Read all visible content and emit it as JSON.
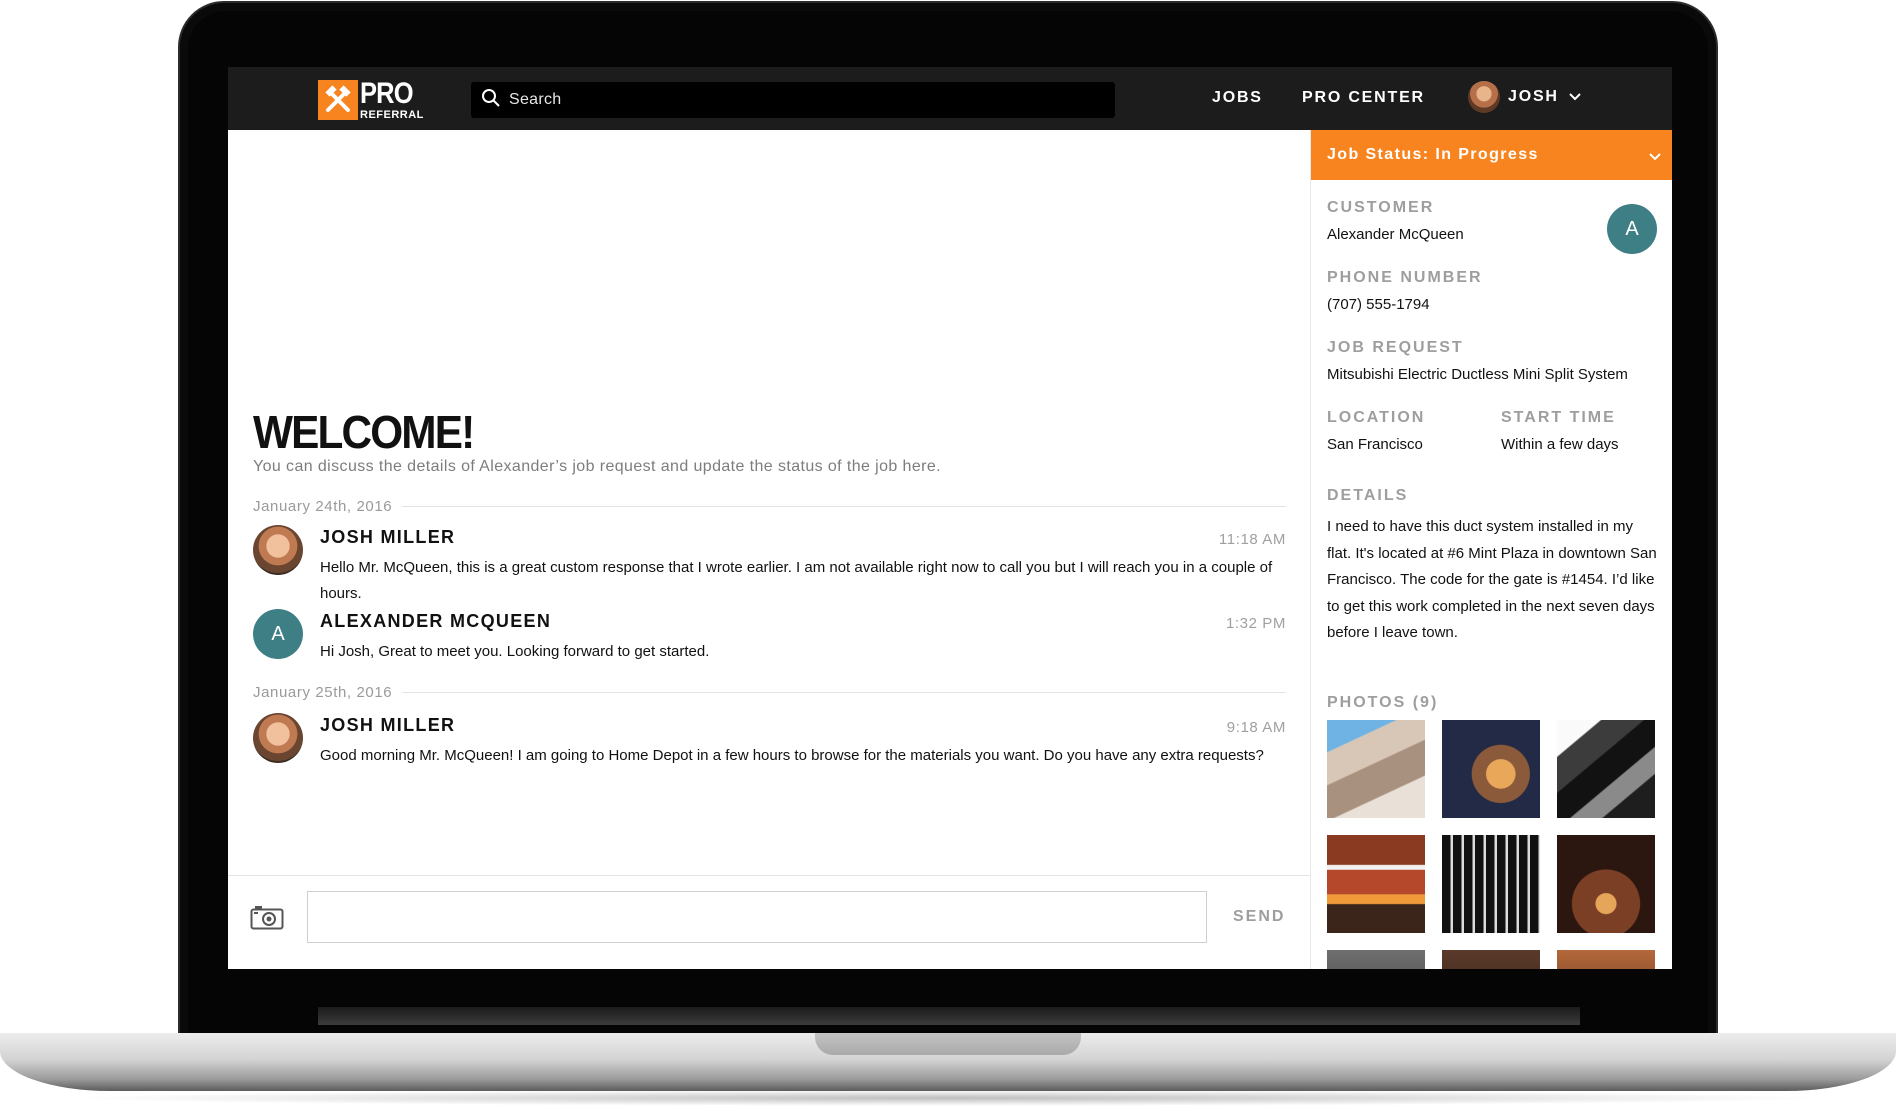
{
  "brand": {
    "name_line1": "PRO",
    "name_line2": "REFERRAL",
    "accent": "#f7841e",
    "dark": "#1c1c1c",
    "teal": "#3e7f85"
  },
  "nav": {
    "search_placeholder": "Search",
    "jobs_label": "JOBS",
    "pro_center_label": "PRO CENTER",
    "user_name": "JOSH"
  },
  "main": {
    "welcome_title": "WELCOME!",
    "welcome_subtitle": "You can discuss the details of Alexander’s job request and update the status of the job here.",
    "threads": [
      {
        "date": "January 24th, 2016",
        "messages": [
          {
            "author": "JOSH MILLER",
            "time": "11:18 AM",
            "text": "Hello Mr. McQueen, this is a great custom response that I wrote earlier. I am not available right now to call you but I will reach you in a couple of hours."
          },
          {
            "author": "ALEXANDER MCQUEEN",
            "avatar_initial": "A",
            "time": "1:32 PM",
            "text": "Hi Josh, Great to meet you. Looking forward to get started."
          }
        ]
      },
      {
        "date": "January 25th, 2016",
        "messages": [
          {
            "author": "JOSH MILLER",
            "time": "9:18 AM",
            "text": "Good morning Mr. McQueen! I am going to Home Depot in a few hours to browse for the materials you want. Do you have any extra requests?"
          }
        ]
      }
    ],
    "compose": {
      "send_label": "SEND",
      "input_value": ""
    }
  },
  "sidebar": {
    "job_status": "Job Status: In Progress",
    "customer_label": "CUSTOMER",
    "customer_name": "Alexander McQueen",
    "customer_initial": "A",
    "phone_label": "PHONE NUMBER",
    "phone_value": "(707) 555-1794",
    "job_request_label": "JOB REQUEST",
    "job_request_value": "Mitsubishi Electric Ductless Mini Split System",
    "location_label": "LOCATION",
    "location_value": "San Francisco",
    "start_time_label": "START TIME",
    "start_time_value": "Within a few days",
    "details_label": "DETAILS",
    "details_value": "I need to have this duct system installed in my flat. It's located at #6 Mint Plaza in downtown San Francisco. The code for the gate is #1454. I’d like to get this work completed in the next seven days before I leave town.",
    "photos_label": "PHOTOS (9)"
  }
}
